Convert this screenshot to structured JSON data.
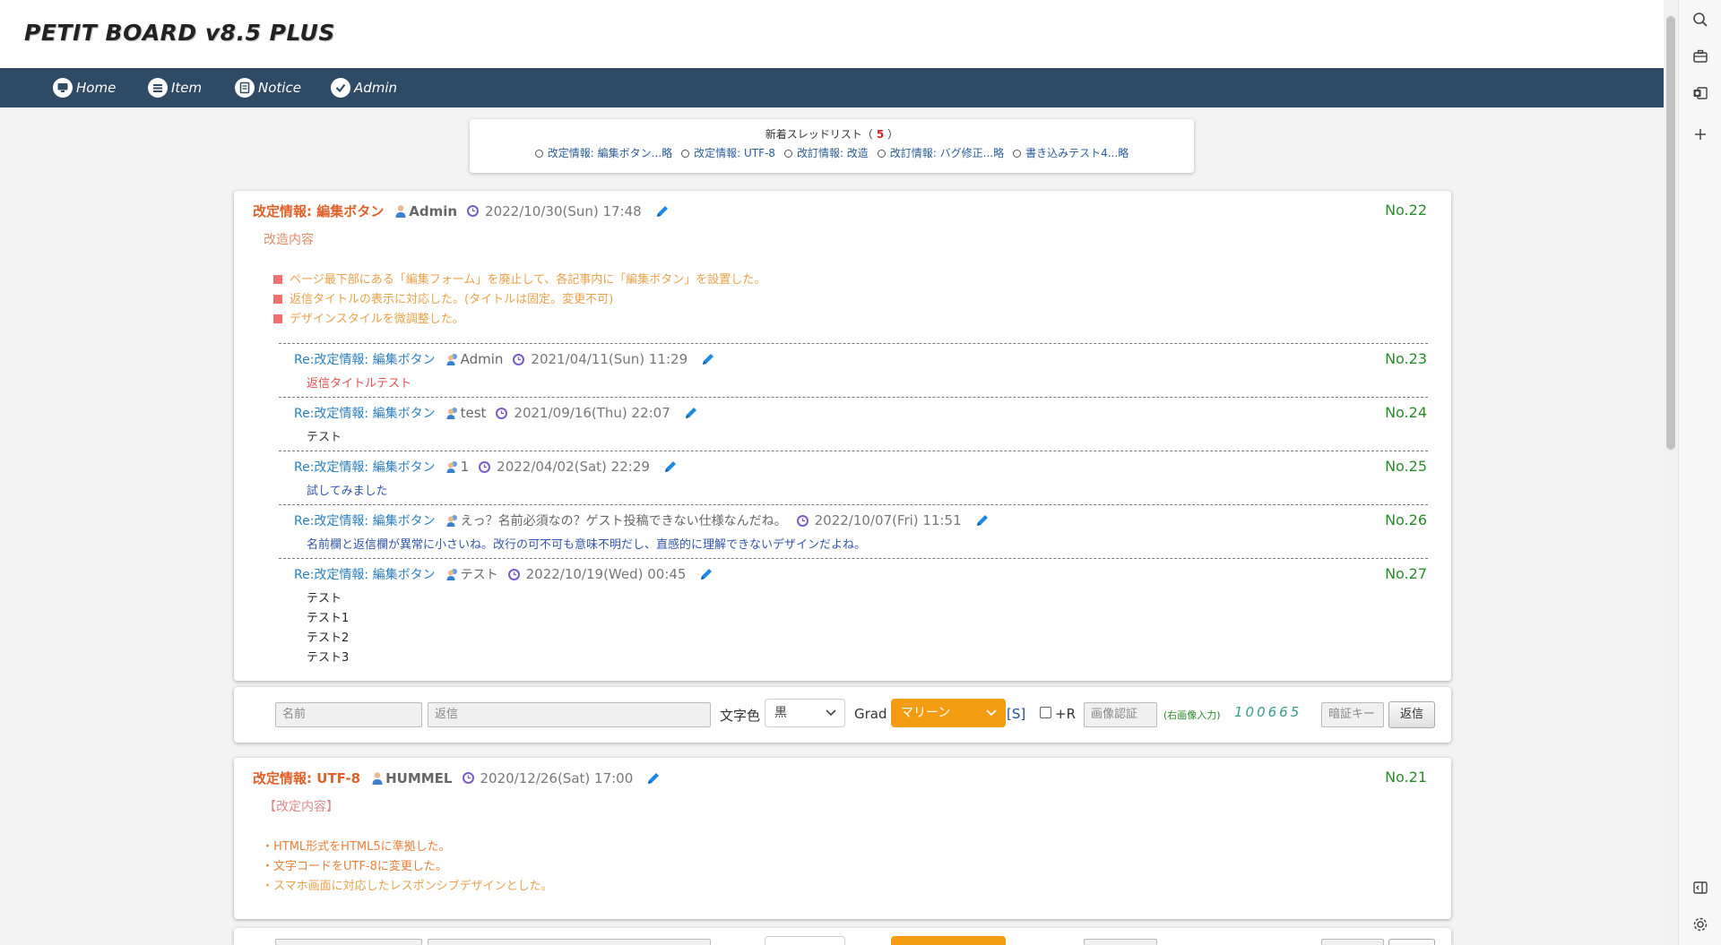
{
  "app": {
    "title": "PETIT BOARD v8.5 PLUS"
  },
  "nav": [
    {
      "label": "Home",
      "icon": "monitor-icon"
    },
    {
      "label": "Item",
      "icon": "list-icon"
    },
    {
      "label": "Notice",
      "icon": "document-icon"
    },
    {
      "label": "Admin",
      "icon": "check-icon"
    }
  ],
  "thread_list": {
    "title_prefix": "新着スレッドリスト（",
    "count": "5",
    "title_suffix": "）",
    "links": [
      "改定情報: 編集ボタン...略",
      "改定情報: UTF-8",
      "改訂情報: 改造",
      "改訂情報: バグ修正...略",
      "書き込みテスト4...略"
    ]
  },
  "thread1": {
    "title": "改定情報: 編集ボタン",
    "name": "Admin",
    "date": "2022/10/30(Sun) 17:48",
    "no": "No.22",
    "body_heading": "改造内容",
    "bullets": [
      "ページ最下部にある「編集フォーム」を廃止して、各記事内に「編集ボタン」を設置した。",
      "返信タイトルの表示に対応した。(タイトルは固定。変更不可)",
      "デザインスタイルを微調整した。"
    ],
    "replies": [
      {
        "title": "Re:改定情報: 編集ボタン",
        "name": "Admin",
        "date": "2021/04/11(Sun) 11:29",
        "no": "No.23",
        "body": [
          "返信タイトルテスト"
        ],
        "color": "#e05050"
      },
      {
        "title": "Re:改定情報: 編集ボタン",
        "name": "test",
        "date": "2021/09/16(Thu) 22:07",
        "no": "No.24",
        "body": [
          "テスト"
        ],
        "color": "#333333"
      },
      {
        "title": "Re:改定情報: 編集ボタン",
        "name": "1",
        "date": "2022/04/02(Sat) 22:29",
        "no": "No.25",
        "body": [
          "試してみました"
        ],
        "color": "#3355aa"
      },
      {
        "title": "Re:改定情報: 編集ボタン",
        "name": "えっ？名前必須なの？ゲスト投稿できない仕様なんだね。",
        "date": "2022/10/07(Fri) 11:51",
        "no": "No.26",
        "body": [
          "名前欄と返信欄が異常に小さいね。改行の可不可も意味不明だし、直感的に理解できないデザインだよね。"
        ],
        "color": "#3355aa"
      },
      {
        "title": "Re:改定情報: 編集ボタン",
        "name": "テスト",
        "date": "2022/10/19(Wed) 00:45",
        "no": "No.27",
        "body": [
          "テスト",
          "テスト1",
          "テスト2",
          "テスト3"
        ],
        "color": "#222222"
      }
    ]
  },
  "reply_form": {
    "name_placeholder": "名前",
    "reply_placeholder": "返信",
    "color_label": "文字色",
    "color_value": "黒",
    "grad_label": "Grad",
    "grad_value": "マリーン",
    "s_link": "[S]",
    "r_label": "+R",
    "captcha_placeholder": "画像認証",
    "captcha_hint": "(右画像入力)",
    "captcha_code": "100665",
    "key_placeholder": "暗証キー",
    "submit_label": "返信"
  },
  "thread2": {
    "title": "改定情報: UTF-8",
    "name": "HUMMEL",
    "date": "2020/12/26(Sat) 17:00",
    "no": "No.21",
    "body_heading": "【改定内容】",
    "lines": [
      "・HTML形式をHTML5に準拠した。",
      "・文字コードをUTF-8に変更した。",
      "・スマホ画面に対応したレスポンシブデザインとした。"
    ]
  },
  "colors": {
    "nav_bg": "#2f4a65",
    "accent_orange": "#f39c12",
    "post_no_green": "#2a8a2a",
    "title_orange": "#e0602a"
  },
  "rail_icons": [
    "search-icon",
    "briefcase-icon",
    "outlook-icon",
    "plus-icon",
    "sidebar-toggle-icon",
    "settings-icon"
  ]
}
